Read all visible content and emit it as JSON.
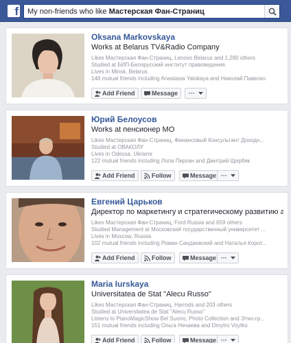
{
  "search": {
    "query_prefix": "My non-friends who like ",
    "query_page": "Мастерская Фан-Страниц"
  },
  "buttons": {
    "add_friend": "Add Friend",
    "message": "Message",
    "follow": "Follow",
    "more": "···"
  },
  "people": [
    {
      "name": "Oksana Markovskaya",
      "subtitle": "Works at Belarus TV&Radio Company",
      "likes": "Likes Мастерская Фан-Страниц, Lenovo Belarus and 1,280 others",
      "studied": "Studied at БИП-Белорусский институт правоведения.",
      "lives": "Lives in Minsk, Belarus",
      "mutual": "148 mutual friends including Anastasia Yatskaya and Николай Павелко"
    },
    {
      "name": "Юрий Белоусов",
      "subtitle": "Works at пенсионер МО",
      "likes": "Likes Мастерская Фан-Страниц, Финансовый Консультант Доходн...",
      "studied": "Studied at ОВАКОЛУ",
      "lives": "Lives in Odessa, Ukraine",
      "mutual": "122 mutual friends including Лола Пирхан and Дмитрий Щербяк"
    },
    {
      "name": "Евгений Царьков",
      "subtitle": "Директор по маркетингу и стратегическому развитию at Buz...",
      "likes": "Likes Мастерская Фан-Страниц, Ford Russia and 659 others",
      "studied": "Studied Management at Московский государственный университет ...",
      "lives": "Lives in Moscow, Russia",
      "mutual": "102 mutual friends including Роман Сандаевский and Наталья Корот..."
    },
    {
      "name": "Maria Iurskaya",
      "subtitle": "Universitatea de Stat \"Alecu Russo\"",
      "likes": "Likes Мастерская Фан-Страниц, Harrods and 203 others",
      "studied": "Studied at Universitatea de Stat \"Alecu Russo\"",
      "listens": "Listens to PianoMagicShow Bel Suono, Photo Collection and Этно-гр...",
      "mutual": "151 mutual friends including Ольга Нечаева and Dmytro Voytko"
    }
  ]
}
